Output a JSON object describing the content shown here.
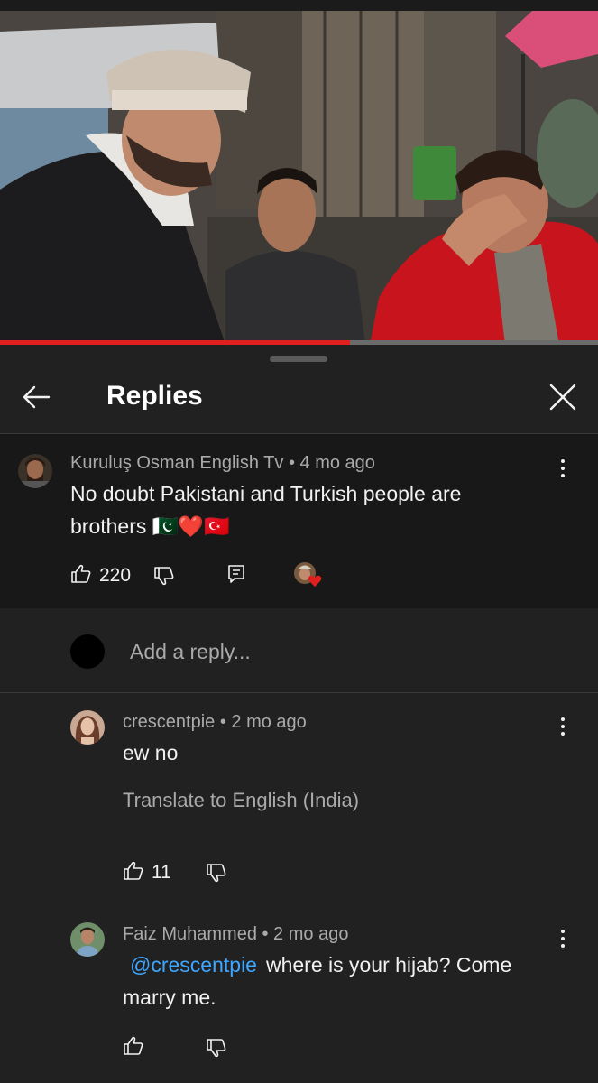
{
  "video": {
    "progress_fraction": 0.585
  },
  "header": {
    "title": "Replies",
    "back_icon": "arrow-left-icon",
    "close_icon": "close-icon"
  },
  "parent_comment": {
    "author": "Kuruluş Osman English Tv",
    "time": "• 4 mo ago",
    "text": "No doubt Pakistani and Turkish people are brothers 🇵🇰❤️🇹🇷",
    "likes": "220"
  },
  "reply_box": {
    "placeholder": "Add a reply..."
  },
  "replies": [
    {
      "author": "crescentpie",
      "time": "• 2 mo ago",
      "text": "ew no",
      "translate": "Translate to English (India)",
      "likes": "11"
    },
    {
      "author": "Faiz Muhammed",
      "time": "• 2 mo ago",
      "mention": "@crescentpie",
      "text": "where is your hijab? Come marry me.",
      "likes": ""
    }
  ],
  "colors": {
    "background": "#212121",
    "parent_background": "#181818",
    "accent_red": "#e0201f",
    "mention_blue": "#3ea6ff",
    "meta_gray": "#aaaaaa"
  }
}
